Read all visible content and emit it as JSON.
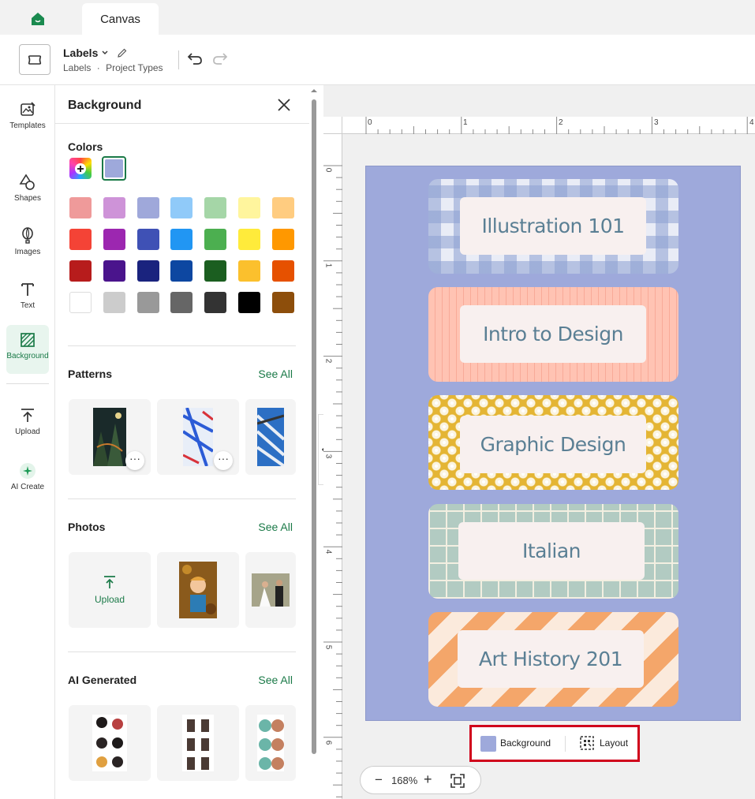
{
  "app": {
    "tab_label": "Canvas"
  },
  "toolbar": {
    "project_title": "Labels",
    "breadcrumb_1": "Labels",
    "breadcrumb_sep": "·",
    "breadcrumb_2": "Project Types"
  },
  "nav": {
    "templates": "Templates",
    "shapes": "Shapes",
    "images": "Images",
    "text": "Text",
    "background": "Background",
    "upload": "Upload",
    "ai_create": "AI Create"
  },
  "panel": {
    "title": "Background",
    "colors_title": "Colors",
    "selected_color": "#9ea9db",
    "color_rows": [
      [
        "#ef9a9a",
        "#ce93d8",
        "#9fa8da",
        "#90caf9",
        "#a5d6a7",
        "#fff59d",
        "#ffcc80"
      ],
      [
        "#f44336",
        "#9c27b0",
        "#3f51b5",
        "#2196f3",
        "#4caf50",
        "#ffeb3b",
        "#ff9800"
      ],
      [
        "#b71c1c",
        "#4a148c",
        "#1a237e",
        "#0d47a1",
        "#1b5e20",
        "#fbc02d",
        "#e65100"
      ],
      [
        "#ffffff",
        "#cccccc",
        "#999999",
        "#666666",
        "#333333",
        "#000000",
        "#8d4e0b"
      ]
    ],
    "patterns_title": "Patterns",
    "patterns_see_all": "See All",
    "photos_title": "Photos",
    "photos_see_all": "See All",
    "upload_label": "Upload",
    "ai_title": "AI Generated",
    "ai_see_all": "See All",
    "more_label": "···"
  },
  "ruler": {
    "top": [
      "0",
      "1",
      "2",
      "3",
      "4"
    ],
    "left": [
      "0",
      "1",
      "2",
      "3",
      "4",
      "5",
      "6"
    ]
  },
  "labels": [
    {
      "text": "Illustration 101",
      "pattern": "gingham",
      "color": "#b8c3e4"
    },
    {
      "text": "Intro to Design",
      "pattern": "stripes-vertical",
      "color": "#ffc3b3"
    },
    {
      "text": "Graphic Design",
      "pattern": "flowers",
      "color": "#e4b534"
    },
    {
      "text": "Italian",
      "pattern": "grid",
      "color": "#b2cbc2"
    },
    {
      "text": "Art History 201",
      "pattern": "diagonal-stripes",
      "color": "#f4a66a"
    }
  ],
  "bottom_bar": {
    "background_label": "Background",
    "layout_label": "Layout"
  },
  "zoom": {
    "minus": "−",
    "value": "168%",
    "plus": "+"
  }
}
